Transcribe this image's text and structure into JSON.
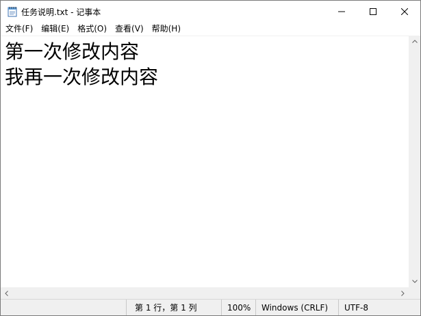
{
  "window": {
    "title": "任务说明.txt - 记事本",
    "icons": {
      "app": "notepad-icon",
      "minimize": "minimize-icon",
      "maximize": "maximize-icon",
      "close": "close-icon"
    }
  },
  "menu": {
    "items": [
      {
        "label": "文件(F)"
      },
      {
        "label": "编辑(E)"
      },
      {
        "label": "格式(O)"
      },
      {
        "label": "查看(V)"
      },
      {
        "label": "帮助(H)"
      }
    ]
  },
  "editor": {
    "lines": [
      "第一次修改内容",
      "我再一次修改内容"
    ]
  },
  "status": {
    "position": "第 1 行，第 1 列",
    "zoom": "100%",
    "line_ending": "Windows (CRLF)",
    "encoding": "UTF-8"
  },
  "colors": {
    "chrome": "#f0f0f0",
    "text": "#000000",
    "border": "#7a7a7a"
  }
}
